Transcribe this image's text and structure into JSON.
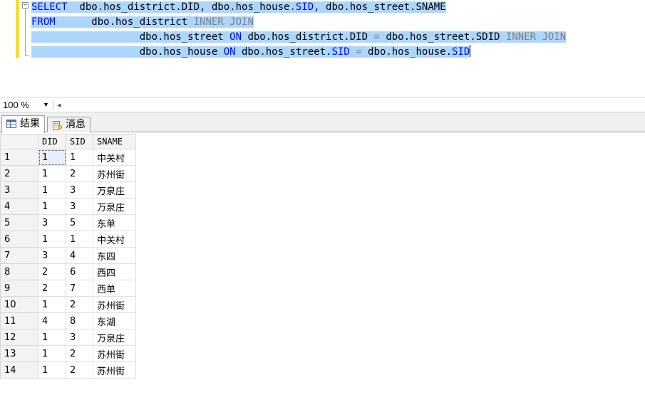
{
  "editor": {
    "lines": [
      [
        {
          "t": "SELECT",
          "c": "kw"
        },
        {
          "t": "  dbo.hos_district.DID, dbo.hos_house.",
          "c": "id"
        },
        {
          "t": "SID",
          "c": "kw"
        },
        {
          "t": ", dbo.hos_street.SNAME",
          "c": "id"
        }
      ],
      [
        {
          "t": "FROM",
          "c": "kw"
        },
        {
          "t": "      dbo.hos_district ",
          "c": "id"
        },
        {
          "t": "INNER JOIN",
          "c": "op"
        }
      ],
      [
        {
          "t": "                  dbo.hos_street ",
          "c": "id"
        },
        {
          "t": "ON",
          "c": "kw"
        },
        {
          "t": " dbo.hos_district.DID ",
          "c": "id"
        },
        {
          "t": "=",
          "c": "op"
        },
        {
          "t": " dbo.hos_street.SDID ",
          "c": "id"
        },
        {
          "t": "INNER JOIN",
          "c": "op"
        }
      ],
      [
        {
          "t": "                  dbo.hos_house ",
          "c": "id"
        },
        {
          "t": "ON",
          "c": "kw"
        },
        {
          "t": " dbo.hos_street.",
          "c": "id"
        },
        {
          "t": "SID",
          "c": "kw"
        },
        {
          "t": " ",
          "c": "id"
        },
        {
          "t": "=",
          "c": "op"
        },
        {
          "t": " dbo.hos_house.",
          "c": "id"
        },
        {
          "t": "SID",
          "c": "kw"
        }
      ]
    ],
    "collapse_glyph": "−"
  },
  "zoom": {
    "value": "100 %",
    "arrow": "▼",
    "scroll_arrow": "◂"
  },
  "tabs": {
    "results_label": "结果",
    "messages_label": "消息"
  },
  "grid": {
    "columns": [
      "DID",
      "SID",
      "SNAME"
    ],
    "rows": [
      [
        "1",
        "1",
        "1",
        "中关村"
      ],
      [
        "2",
        "1",
        "2",
        "苏州街"
      ],
      [
        "3",
        "1",
        "3",
        "万泉庄"
      ],
      [
        "4",
        "1",
        "3",
        "万泉庄"
      ],
      [
        "5",
        "3",
        "5",
        "东单"
      ],
      [
        "6",
        "1",
        "1",
        "中关村"
      ],
      [
        "7",
        "3",
        "4",
        "东四"
      ],
      [
        "8",
        "2",
        "6",
        "西四"
      ],
      [
        "9",
        "2",
        "7",
        "西单"
      ],
      [
        "10",
        "1",
        "2",
        "苏州街"
      ],
      [
        "11",
        "4",
        "8",
        "东湖"
      ],
      [
        "12",
        "1",
        "3",
        "万泉庄"
      ],
      [
        "13",
        "1",
        "2",
        "苏州街"
      ],
      [
        "14",
        "1",
        "2",
        "苏州街"
      ]
    ]
  },
  "colors": {
    "selection": "#add6ff",
    "keyword": "#0000ff",
    "operator": "#808080",
    "gutter_change": "#f7e21a"
  }
}
